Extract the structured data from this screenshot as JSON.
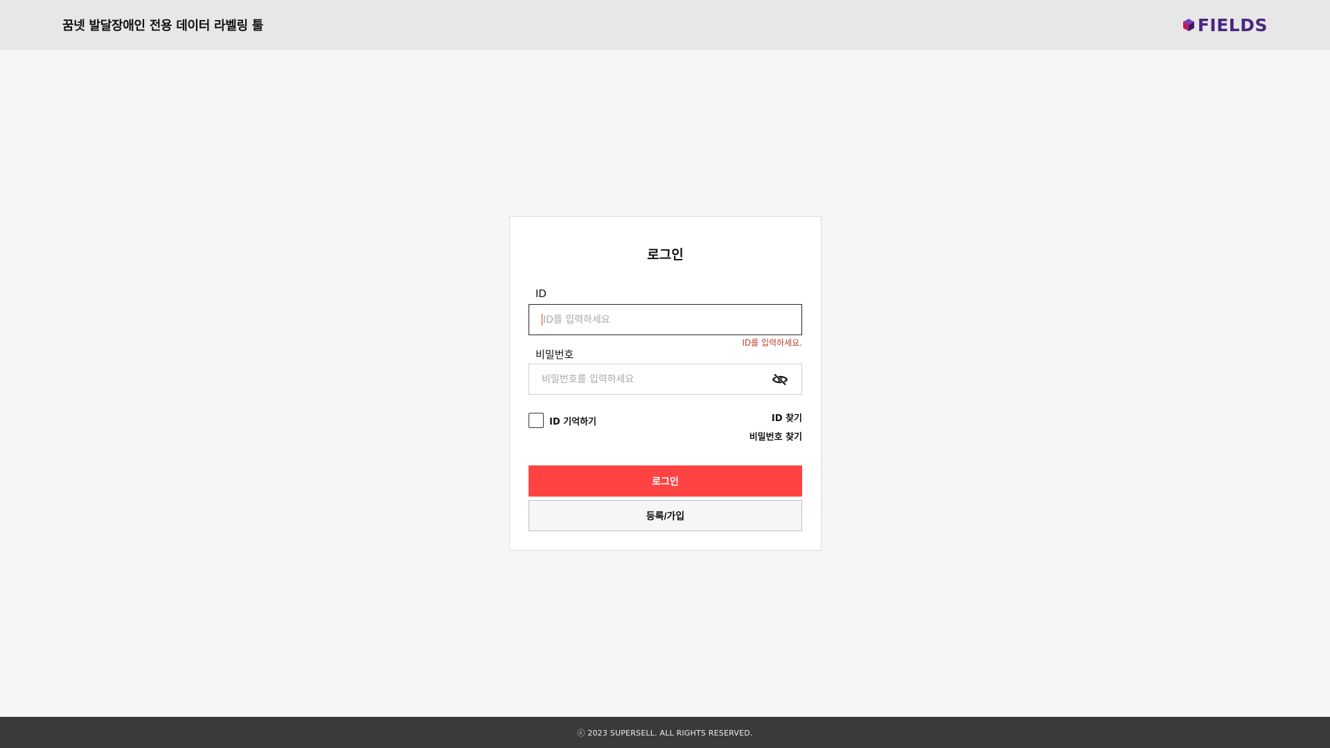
{
  "header": {
    "title": "꿈넷 발달장애인 전용 데이터 라벨링 툴",
    "brand_text": "FIELDS",
    "brand_color": "#4a2580"
  },
  "login": {
    "title": "로그인",
    "id_label": "ID",
    "id_placeholder": "ID를 입력하세요",
    "id_value": "",
    "id_error": "ID를 입력하세요.",
    "password_label": "비밀번호",
    "password_placeholder": "비밀번호를 입력하세요",
    "password_value": "",
    "password_toggle_icon": "eye-off-icon",
    "remember_label": "ID 기억하기",
    "remember_checked": false,
    "find_id_label": "ID 찾기",
    "find_password_label": "비밀번호 찾기",
    "login_button": "로그인",
    "register_button": "등록/가입",
    "login_button_color": "#ff4343",
    "error_color": "#c0392b"
  },
  "footer": {
    "copyright": "ⓒ 2023 SUPERSELL. ALL RIGHTS RESERVED."
  }
}
